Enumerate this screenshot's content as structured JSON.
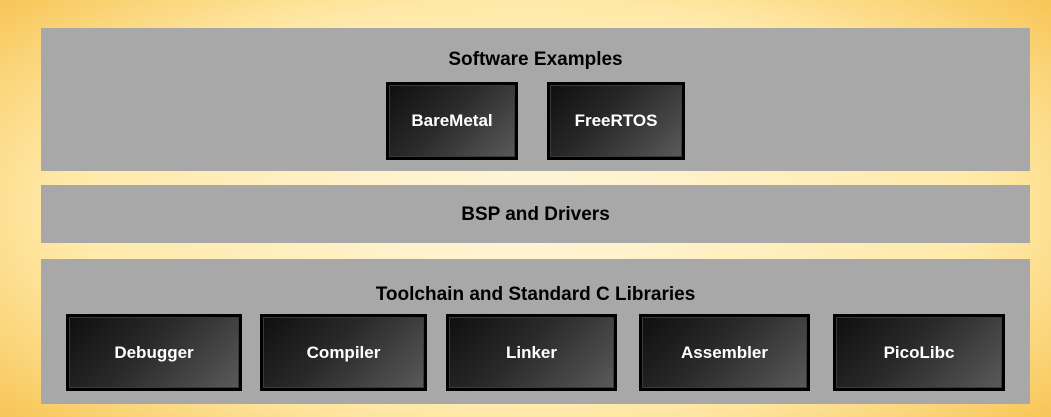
{
  "layers": {
    "software_examples": {
      "title": "Software Examples",
      "items": [
        "BareMetal",
        "FreeRTOS"
      ]
    },
    "bsp": {
      "title": "BSP and Drivers"
    },
    "toolchain": {
      "title": "Toolchain and Standard C Libraries",
      "items": [
        "Debugger",
        "Compiler",
        "Linker",
        "Assembler",
        "PicoLibc"
      ]
    }
  },
  "colors": {
    "frame_center": "#fff6dc",
    "frame_edge": "#eda71d",
    "panel": "#a8a8a8",
    "chip_dark": "#0f0f0f",
    "chip_light": "#5a5a5a"
  }
}
